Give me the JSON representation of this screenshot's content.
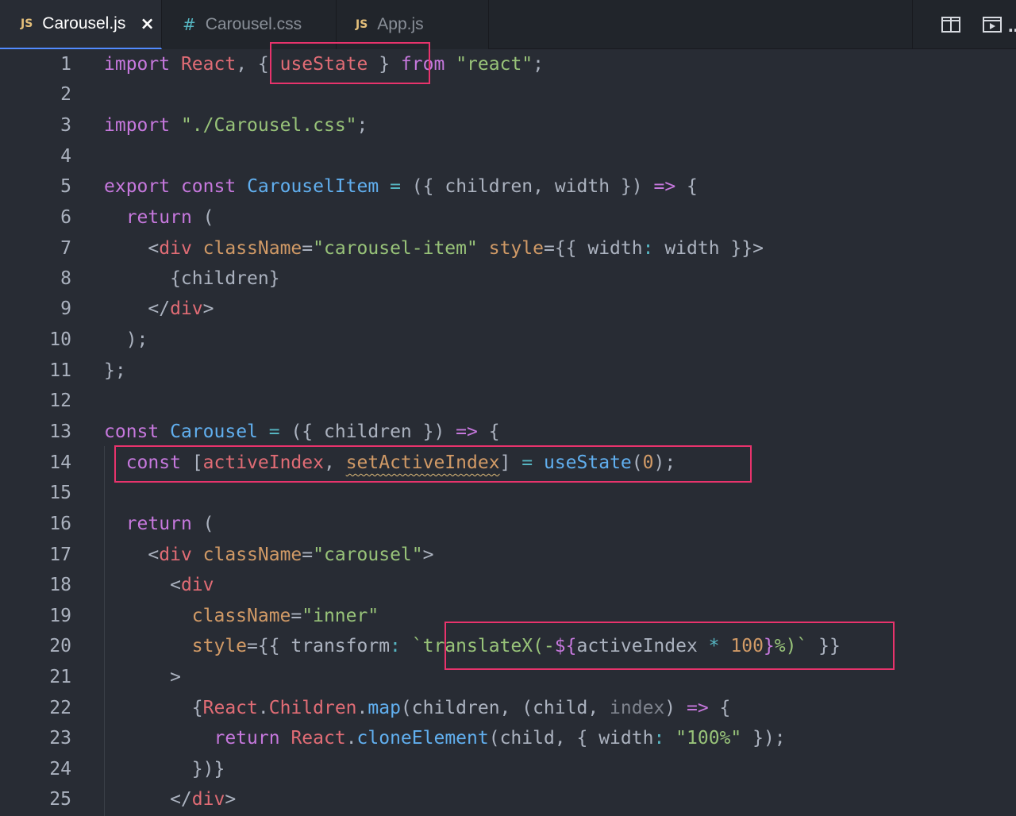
{
  "tabs": [
    {
      "icon": "JS",
      "label": "Carousel.js",
      "active": true,
      "close": "×"
    },
    {
      "icon": "#",
      "label": "Carousel.css",
      "active": false
    },
    {
      "icon": "JS",
      "label": "App.js",
      "active": false
    }
  ],
  "editor": {
    "line_numbers": [
      "1",
      "2",
      "3",
      "4",
      "5",
      "6",
      "7",
      "8",
      "9",
      "10",
      "11",
      "12",
      "13",
      "14",
      "15",
      "16",
      "17",
      "18",
      "19",
      "20",
      "21",
      "22",
      "23",
      "24",
      "25"
    ],
    "highlights": [
      "{ useState }",
      "const [activeIndex, setActiveIndex] = useState(0);",
      "`translateX(-${activeIndex * 100}%)`"
    ],
    "lines": [
      [
        [
          "kw",
          "import"
        ],
        [
          "pl",
          " "
        ],
        [
          "id",
          "React"
        ],
        [
          "pl",
          ", "
        ],
        [
          "pl",
          "{ "
        ],
        [
          "id",
          "useState"
        ],
        [
          "pl",
          " }"
        ],
        [
          "pl",
          " "
        ],
        [
          "kw",
          "from"
        ],
        [
          "pl",
          " "
        ],
        [
          "str",
          "\"react\""
        ],
        [
          "pl",
          ";"
        ]
      ],
      [],
      [
        [
          "kw",
          "import"
        ],
        [
          "pl",
          " "
        ],
        [
          "str",
          "\"./Carousel.css\""
        ],
        [
          "pl",
          ";"
        ]
      ],
      [],
      [
        [
          "kw",
          "export"
        ],
        [
          "pl",
          " "
        ],
        [
          "kw",
          "const"
        ],
        [
          "pl",
          " "
        ],
        [
          "fn",
          "CarouselItem"
        ],
        [
          "pl",
          " "
        ],
        [
          "op",
          "="
        ],
        [
          "pl",
          " ({ "
        ],
        [
          "pl",
          "children"
        ],
        [
          "pl",
          ", "
        ],
        [
          "pl",
          "width"
        ],
        [
          "pl",
          " }) "
        ],
        [
          "kw",
          "=>"
        ],
        [
          "pl",
          " {"
        ]
      ],
      [
        [
          "pl",
          "  "
        ],
        [
          "kw",
          "return"
        ],
        [
          "pl",
          " ("
        ]
      ],
      [
        [
          "pl",
          "    <"
        ],
        [
          "tg",
          "div"
        ],
        [
          "pl",
          " "
        ],
        [
          "at",
          "className"
        ],
        [
          "pl",
          "="
        ],
        [
          "str",
          "\"carousel-item\""
        ],
        [
          "pl",
          " "
        ],
        [
          "at",
          "style"
        ],
        [
          "pl",
          "={{ "
        ],
        [
          "pl",
          "width"
        ],
        [
          "op",
          ":"
        ],
        [
          "pl",
          " width }}>"
        ]
      ],
      [
        [
          "pl",
          "      {children}"
        ]
      ],
      [
        [
          "pl",
          "    </"
        ],
        [
          "tg",
          "div"
        ],
        [
          "pl",
          ">"
        ]
      ],
      [
        [
          "pl",
          "  );"
        ]
      ],
      [
        [
          "pl",
          "};"
        ]
      ],
      [],
      [
        [
          "kw",
          "const"
        ],
        [
          "pl",
          " "
        ],
        [
          "fn",
          "Carousel"
        ],
        [
          "pl",
          " "
        ],
        [
          "op",
          "="
        ],
        [
          "pl",
          " ({ children }) "
        ],
        [
          "kw",
          "=>"
        ],
        [
          "pl",
          " {"
        ]
      ],
      [
        [
          "pl",
          "  "
        ],
        [
          "kw",
          "const"
        ],
        [
          "pl",
          " ["
        ],
        [
          "id",
          "activeIndex"
        ],
        [
          "pl",
          ", "
        ],
        [
          "at squig",
          "setActiveIndex"
        ],
        [
          "pl",
          "] "
        ],
        [
          "op",
          "="
        ],
        [
          "pl",
          " "
        ],
        [
          "fn",
          "useState"
        ],
        [
          "pl",
          "("
        ],
        [
          "num",
          "0"
        ],
        [
          "pl",
          ");"
        ]
      ],
      [],
      [
        [
          "pl",
          "  "
        ],
        [
          "kw",
          "return"
        ],
        [
          "pl",
          " ("
        ]
      ],
      [
        [
          "pl",
          "    <"
        ],
        [
          "tg",
          "div"
        ],
        [
          "pl",
          " "
        ],
        [
          "at",
          "className"
        ],
        [
          "pl",
          "="
        ],
        [
          "str",
          "\"carousel\""
        ],
        [
          "pl",
          ">"
        ]
      ],
      [
        [
          "pl",
          "      <"
        ],
        [
          "tg",
          "div"
        ]
      ],
      [
        [
          "pl",
          "        "
        ],
        [
          "at",
          "className"
        ],
        [
          "pl",
          "="
        ],
        [
          "str",
          "\"inner\""
        ]
      ],
      [
        [
          "pl",
          "        "
        ],
        [
          "at",
          "style"
        ],
        [
          "pl",
          "={{ "
        ],
        [
          "pl",
          "transform"
        ],
        [
          "op",
          ":"
        ],
        [
          "pl",
          " "
        ],
        [
          "str",
          "`translateX(-"
        ],
        [
          "kw",
          "${"
        ],
        [
          "pl",
          "activeIndex "
        ],
        [
          "op",
          "*"
        ],
        [
          "pl",
          " "
        ],
        [
          "num",
          "100"
        ],
        [
          "kw",
          "}"
        ],
        [
          "str",
          "%)`"
        ],
        [
          "pl",
          " }}"
        ]
      ],
      [
        [
          "pl",
          "      >"
        ]
      ],
      [
        [
          "pl",
          "        {"
        ],
        [
          "id",
          "React"
        ],
        [
          "pl",
          "."
        ],
        [
          "id",
          "Children"
        ],
        [
          "pl",
          "."
        ],
        [
          "fn",
          "map"
        ],
        [
          "pl",
          "(children, (child, "
        ],
        [
          "dim",
          "index"
        ],
        [
          "pl",
          ") "
        ],
        [
          "kw",
          "=>"
        ],
        [
          "pl",
          " {"
        ]
      ],
      [
        [
          "pl",
          "          "
        ],
        [
          "kw",
          "return"
        ],
        [
          "pl",
          " "
        ],
        [
          "id",
          "React"
        ],
        [
          "pl",
          "."
        ],
        [
          "fn",
          "cloneElement"
        ],
        [
          "pl",
          "(child, { "
        ],
        [
          "pl",
          "width"
        ],
        [
          "op",
          ":"
        ],
        [
          "pl",
          " "
        ],
        [
          "str",
          "\"100%\""
        ],
        [
          "pl",
          " });"
        ]
      ],
      [
        [
          "pl",
          "        })}"
        ]
      ],
      [
        [
          "pl",
          "      </"
        ],
        [
          "tg",
          "div"
        ],
        [
          "pl",
          ">"
        ]
      ]
    ]
  }
}
